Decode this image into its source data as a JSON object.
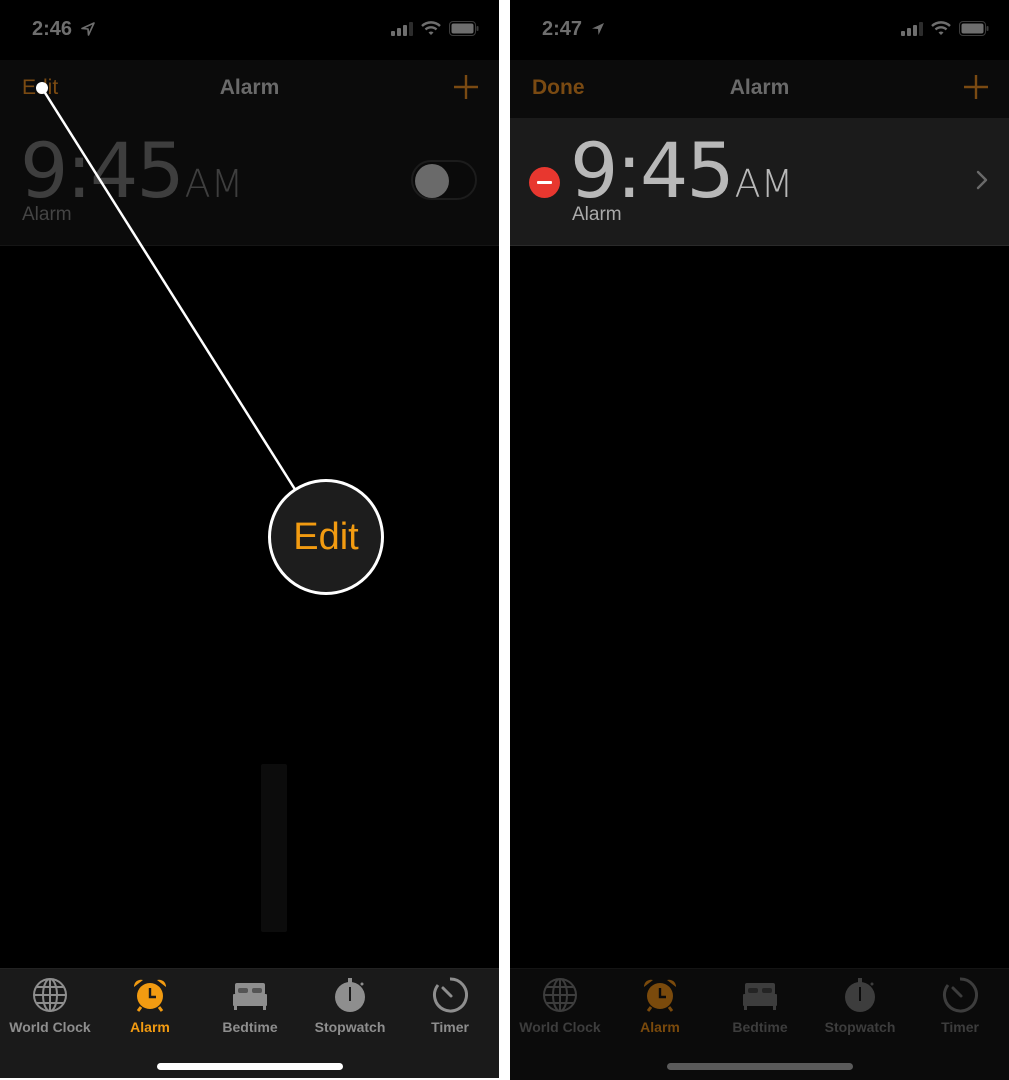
{
  "colors": {
    "accent": "#f29b11",
    "accent_dim": "#7a4a12",
    "delete_red": "#e8372f",
    "background": "#000000"
  },
  "left_screen": {
    "status_bar": {
      "time": "2:46",
      "icons": [
        "location-arrow-icon",
        "cellular-signal-icon",
        "wifi-icon",
        "battery-icon"
      ]
    },
    "nav_bar": {
      "left_button": "Edit",
      "title": "Alarm",
      "right_icon": "plus-icon"
    },
    "alarms": [
      {
        "time": "9:45",
        "period": "AM",
        "label": "Alarm",
        "enabled": false
      }
    ],
    "callout": {
      "text": "Edit"
    },
    "tabs": [
      {
        "label": "World Clock",
        "icon": "globe-icon",
        "active": false
      },
      {
        "label": "Alarm",
        "icon": "alarm-clock-icon",
        "active": true
      },
      {
        "label": "Bedtime",
        "icon": "bed-icon",
        "active": false
      },
      {
        "label": "Stopwatch",
        "icon": "stopwatch-icon",
        "active": false
      },
      {
        "label": "Timer",
        "icon": "timer-icon",
        "active": false
      }
    ]
  },
  "right_screen": {
    "status_bar": {
      "time": "2:47",
      "icons": [
        "location-arrow-icon",
        "cellular-signal-icon",
        "wifi-icon",
        "battery-icon"
      ]
    },
    "nav_bar": {
      "left_button": "Done",
      "title": "Alarm",
      "right_icon": "plus-icon"
    },
    "alarms": [
      {
        "time": "9:45",
        "period": "AM",
        "label": "Alarm",
        "edit_mode": true
      }
    ],
    "tabs": [
      {
        "label": "World Clock",
        "icon": "globe-icon",
        "active": false
      },
      {
        "label": "Alarm",
        "icon": "alarm-clock-icon",
        "active": true
      },
      {
        "label": "Bedtime",
        "icon": "bed-icon",
        "active": false
      },
      {
        "label": "Stopwatch",
        "icon": "stopwatch-icon",
        "active": false
      },
      {
        "label": "Timer",
        "icon": "timer-icon",
        "active": false
      }
    ]
  }
}
